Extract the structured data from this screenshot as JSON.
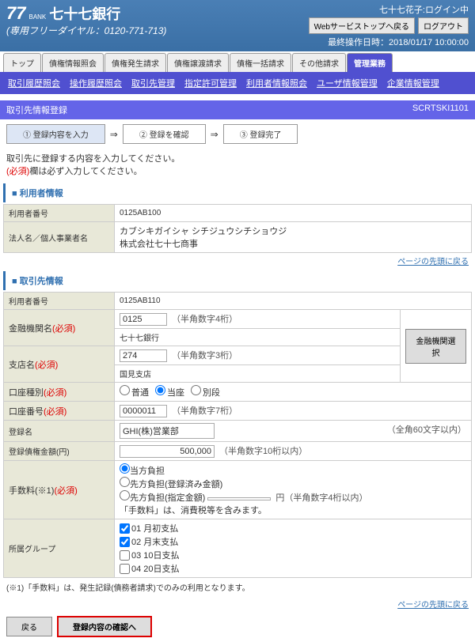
{
  "header": {
    "bank_name": "七十七銀行",
    "dial": "(専用フリーダイヤル：0120-771-713)",
    "login_user": "七十七花子:ログイン中",
    "btn_ws_top": "Webサービストップへ戻る",
    "btn_logout": "ログアウト",
    "last_op": "最終操作日時：2018/01/17 10:00:00"
  },
  "tabs": [
    "トップ",
    "債権情報照会",
    "債権発生請求",
    "債権譲渡請求",
    "債権一括請求",
    "その他請求",
    "管理業務"
  ],
  "subnav": [
    "取引履歴照会",
    "操作履歴照会",
    "取引先管理",
    "指定許可管理",
    "利用者情報照会",
    "ユーザ情報管理",
    "企業情報管理"
  ],
  "title": {
    "text": "取引先情報登録",
    "code": "SCRTSKI1101"
  },
  "steps": {
    "s1": "① 登録内容を入力",
    "s2": "② 登録を確認",
    "s3": "③ 登録完了"
  },
  "notes": {
    "l1": "取引先に登録する内容を入力してください。",
    "l2": "(必須)欄は必ず入力してください。",
    "req": "(必須)"
  },
  "sec1": {
    "title": "■ 利用者情報",
    "r1l": "利用者番号",
    "r1v": "0125AB100",
    "r2l": "法人名／個人事業者名",
    "r2v1": "カブシキガイシャ シチジュウシチショウジ",
    "r2v2": "株式会社七十七商事"
  },
  "sec2": {
    "title": "■ 取引先情報",
    "r1l": "利用者番号",
    "r1v": "0125AB110",
    "r2l": "金融機関名",
    "r2v1": "0125",
    "r2h1": "（半角数字4桁）",
    "r2v2": "七十七銀行",
    "btn_search": "金融機関選択",
    "r3l": "支店名",
    "r3v1": "274",
    "r3h1": "（半角数字3桁）",
    "r3v2": "国見支店",
    "r4l": "口座種別",
    "r4o1": "普通",
    "r4o2": "当座",
    "r4o3": "別段",
    "r5l": "口座番号",
    "r5v": "0000011",
    "r5h": "（半角数字7桁）",
    "r6l": "登録名",
    "r6v": "GHI(株)営業部",
    "r6h": "（全角60文字以内）",
    "r7l": "登録債権金額(円)",
    "r7v": "500,000",
    "r7h": "（半角数字10桁以内）",
    "r8l": "手数料(※1)",
    "r8o1": "当方負担",
    "r8o2": "先方負担(登録済み金額)",
    "r8o3": "先方負担(指定金額)",
    "r8h": "円（半角数字4桁以内）",
    "r8note": "「手数料」は、消費税等を含みます。",
    "r9l": "所属グループ",
    "r9o1": "01 月初支払",
    "r9o2": "02 月末支払",
    "r9o3": "03 10日支払",
    "r9o4": "04 20日支払"
  },
  "links": {
    "top": "ページの先頭に戻る"
  },
  "footnote": "(※1)「手数料」は、発生記録(債務者請求)でのみの利用となります。",
  "footer": {
    "back": "戻る",
    "confirm": "登録内容の確認へ"
  }
}
